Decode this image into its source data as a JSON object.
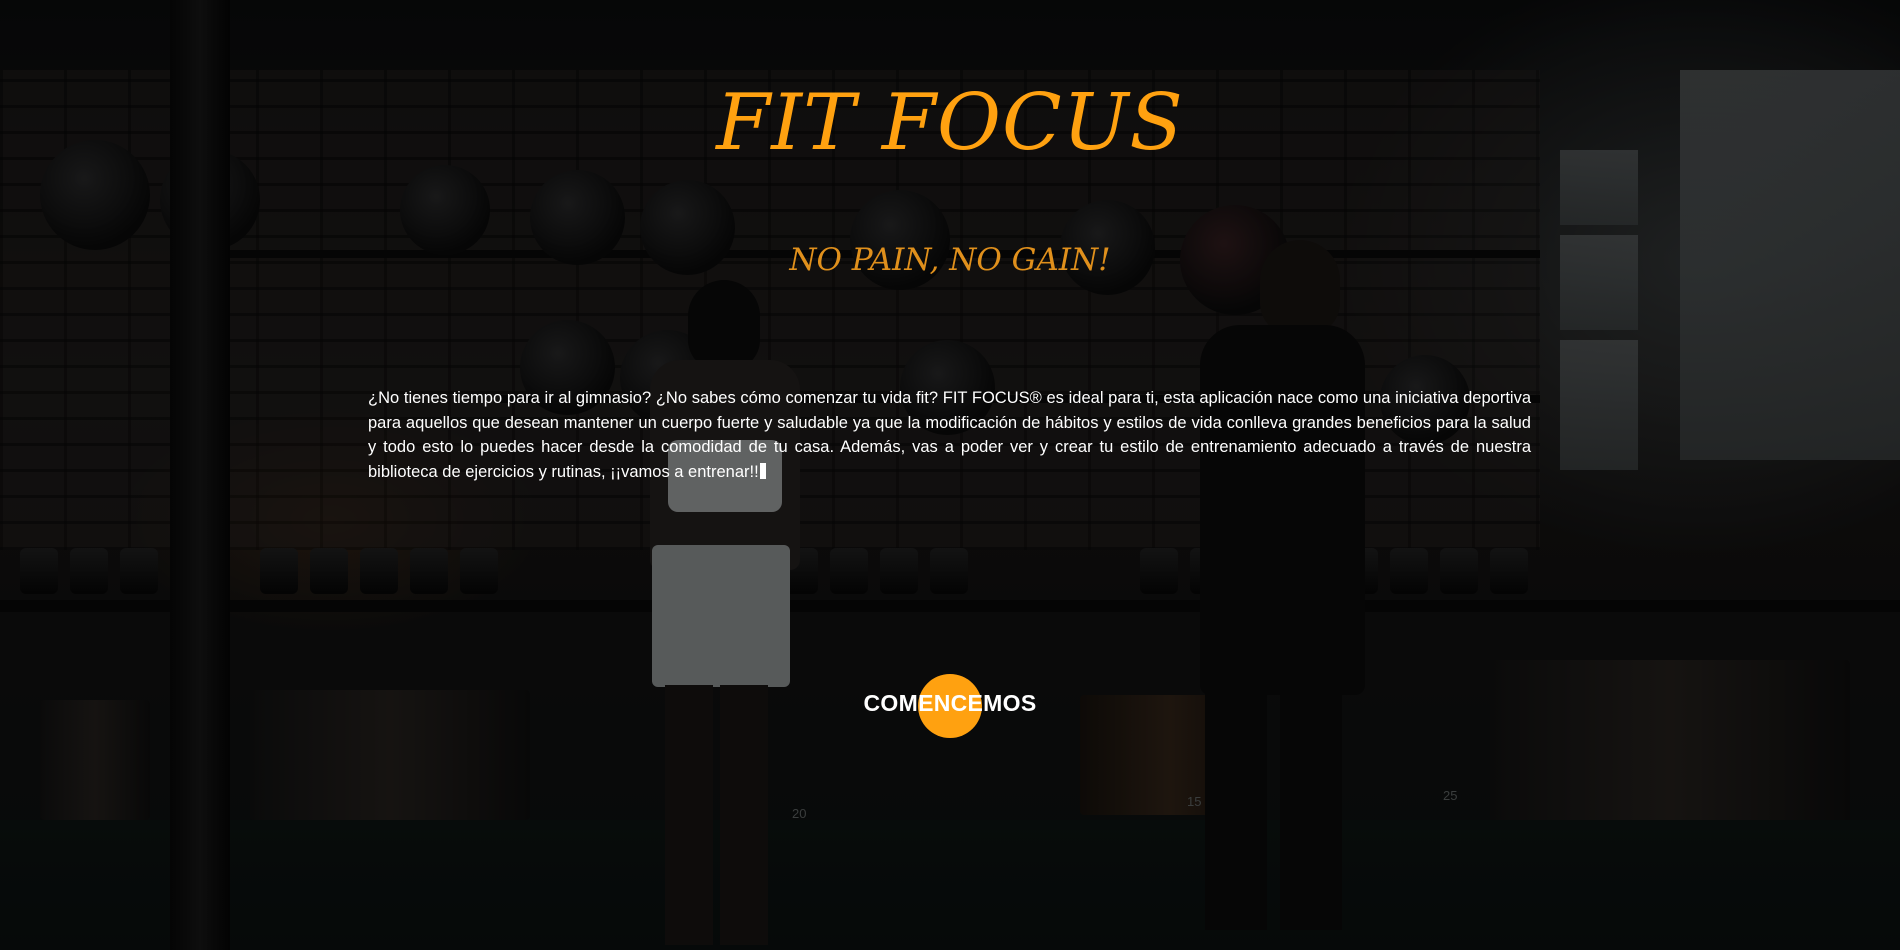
{
  "hero": {
    "title": "FIT FOCUS",
    "tagline": "NO PAIN, NO GAIN!",
    "intro": "¿No tienes tiempo para ir al gimnasio? ¿No sabes cómo comenzar tu vida fit? FIT FOCUS® es ideal para ti, esta aplicación nace como una iniciativa deportiva para aquellos que desean mantener un cuerpo fuerte y saludable ya que la modificación de hábitos y estilos de vida conlleva grandes beneficios para la salud y todo esto lo puedes hacer desde la comodidad de tu casa. Además, vas a poder ver y crear tu estilo de entrenamiento adecuado a través de nuestra biblioteca de ejercicios y rutinas, ¡¡vamos a entrenar!!",
    "cta_label": "COMENCEMOS"
  },
  "background": {
    "plate_numbers": [
      "20",
      "15",
      "25"
    ]
  },
  "colors": {
    "accent": "#ffa110",
    "tagline": "#e0901c",
    "text": "#ffffff"
  }
}
